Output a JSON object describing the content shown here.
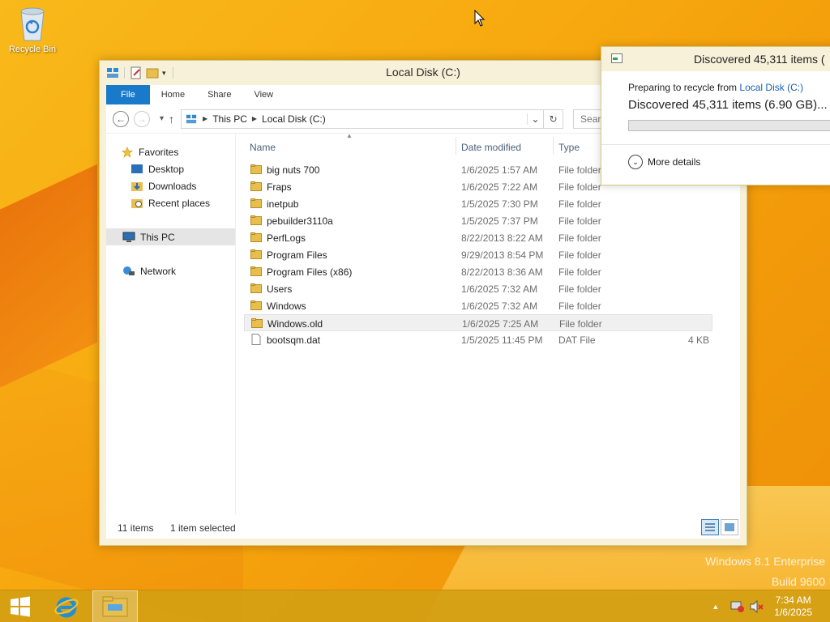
{
  "desktop": {
    "recycle_bin_label": "Recycle Bin",
    "watermark_line1": "Windows 8.1 Enterprise",
    "watermark_line2": "Build 9600"
  },
  "explorer": {
    "title": "Local Disk (C:)",
    "ribbon_tabs": [
      "File",
      "Home",
      "Share",
      "View"
    ],
    "breadcrumb": [
      "This PC",
      "Local Disk (C:)"
    ],
    "search_placeholder": "Search",
    "nav": {
      "favorites": "Favorites",
      "desktop": "Desktop",
      "downloads": "Downloads",
      "recent": "Recent places",
      "this_pc": "This PC",
      "network": "Network"
    },
    "columns": {
      "name": "Name",
      "date": "Date modified",
      "type": "Type"
    },
    "files": [
      {
        "name": "big nuts 700",
        "date": "1/6/2025 1:57 AM",
        "type": "File folder",
        "size": "",
        "kind": "folder"
      },
      {
        "name": "Fraps",
        "date": "1/6/2025 7:22 AM",
        "type": "File folder",
        "size": "",
        "kind": "folder"
      },
      {
        "name": "inetpub",
        "date": "1/5/2025 7:30 PM",
        "type": "File folder",
        "size": "",
        "kind": "folder"
      },
      {
        "name": "pebuilder3110a",
        "date": "1/5/2025 7:37 PM",
        "type": "File folder",
        "size": "",
        "kind": "folder"
      },
      {
        "name": "PerfLogs",
        "date": "8/22/2013 8:22 AM",
        "type": "File folder",
        "size": "",
        "kind": "folder"
      },
      {
        "name": "Program Files",
        "date": "9/29/2013 8:54 PM",
        "type": "File folder",
        "size": "",
        "kind": "folder"
      },
      {
        "name": "Program Files (x86)",
        "date": "8/22/2013 8:36 AM",
        "type": "File folder",
        "size": "",
        "kind": "folder"
      },
      {
        "name": "Users",
        "date": "1/6/2025 7:32 AM",
        "type": "File folder",
        "size": "",
        "kind": "folder"
      },
      {
        "name": "Windows",
        "date": "1/6/2025 7:32 AM",
        "type": "File folder",
        "size": "",
        "kind": "folder"
      },
      {
        "name": "Windows.old",
        "date": "1/6/2025 7:25 AM",
        "type": "File folder",
        "size": "",
        "kind": "folder",
        "selected": true
      },
      {
        "name": "bootsqm.dat",
        "date": "1/5/2025 11:45 PM",
        "type": "DAT File",
        "size": "4 KB",
        "kind": "file"
      }
    ],
    "status_count": "11 items",
    "status_selected": "1 item selected"
  },
  "progress_dialog": {
    "title": "Discovered 45,311 items (",
    "preparing_prefix": "Preparing to recycle from ",
    "preparing_link": "Local Disk (C:)",
    "headline": "Discovered 45,311 items (6.90 GB)...",
    "progress_fraction": 0,
    "more_details": "More details"
  },
  "taskbar": {
    "time": "7:34 AM",
    "date": "1/6/2025"
  },
  "colors": {
    "accent": "#1979ca",
    "folder": "#e8bf4c",
    "desktop": "#f7a90f"
  }
}
